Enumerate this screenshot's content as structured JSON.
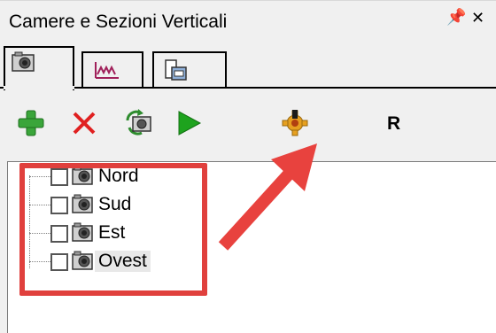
{
  "panel": {
    "title": "Camere e Sezioni Verticali",
    "pin_icon": "pin-icon",
    "close_icon": "close-icon"
  },
  "tabs": [
    {
      "id": "cameras",
      "icon": "camera-icon",
      "active": true
    },
    {
      "id": "profile",
      "icon": "profile-chart-icon",
      "active": false
    },
    {
      "id": "section",
      "icon": "section-view-icon",
      "active": false
    }
  ],
  "toolbar": {
    "buttons": [
      {
        "id": "add",
        "icon": "plus-icon",
        "color": "#2e9c2e"
      },
      {
        "id": "delete",
        "icon": "delete-x-icon",
        "color": "#e02020"
      },
      {
        "id": "refresh",
        "icon": "camera-refresh-icon"
      },
      {
        "id": "play",
        "icon": "play-icon",
        "color": "#1ea31e"
      },
      {
        "id": "settings",
        "icon": "gear-icon",
        "color": "#e0a020"
      }
    ],
    "r_label": "R"
  },
  "tree": {
    "items": [
      {
        "label": "Nord",
        "checked": false,
        "selected": false
      },
      {
        "label": "Sud",
        "checked": false,
        "selected": false
      },
      {
        "label": "Est",
        "checked": false,
        "selected": false
      },
      {
        "label": "Ovest",
        "checked": false,
        "selected": true
      }
    ]
  },
  "annotation": {
    "highlight_color": "#e0403d",
    "arrow_color": "#e8423e"
  }
}
